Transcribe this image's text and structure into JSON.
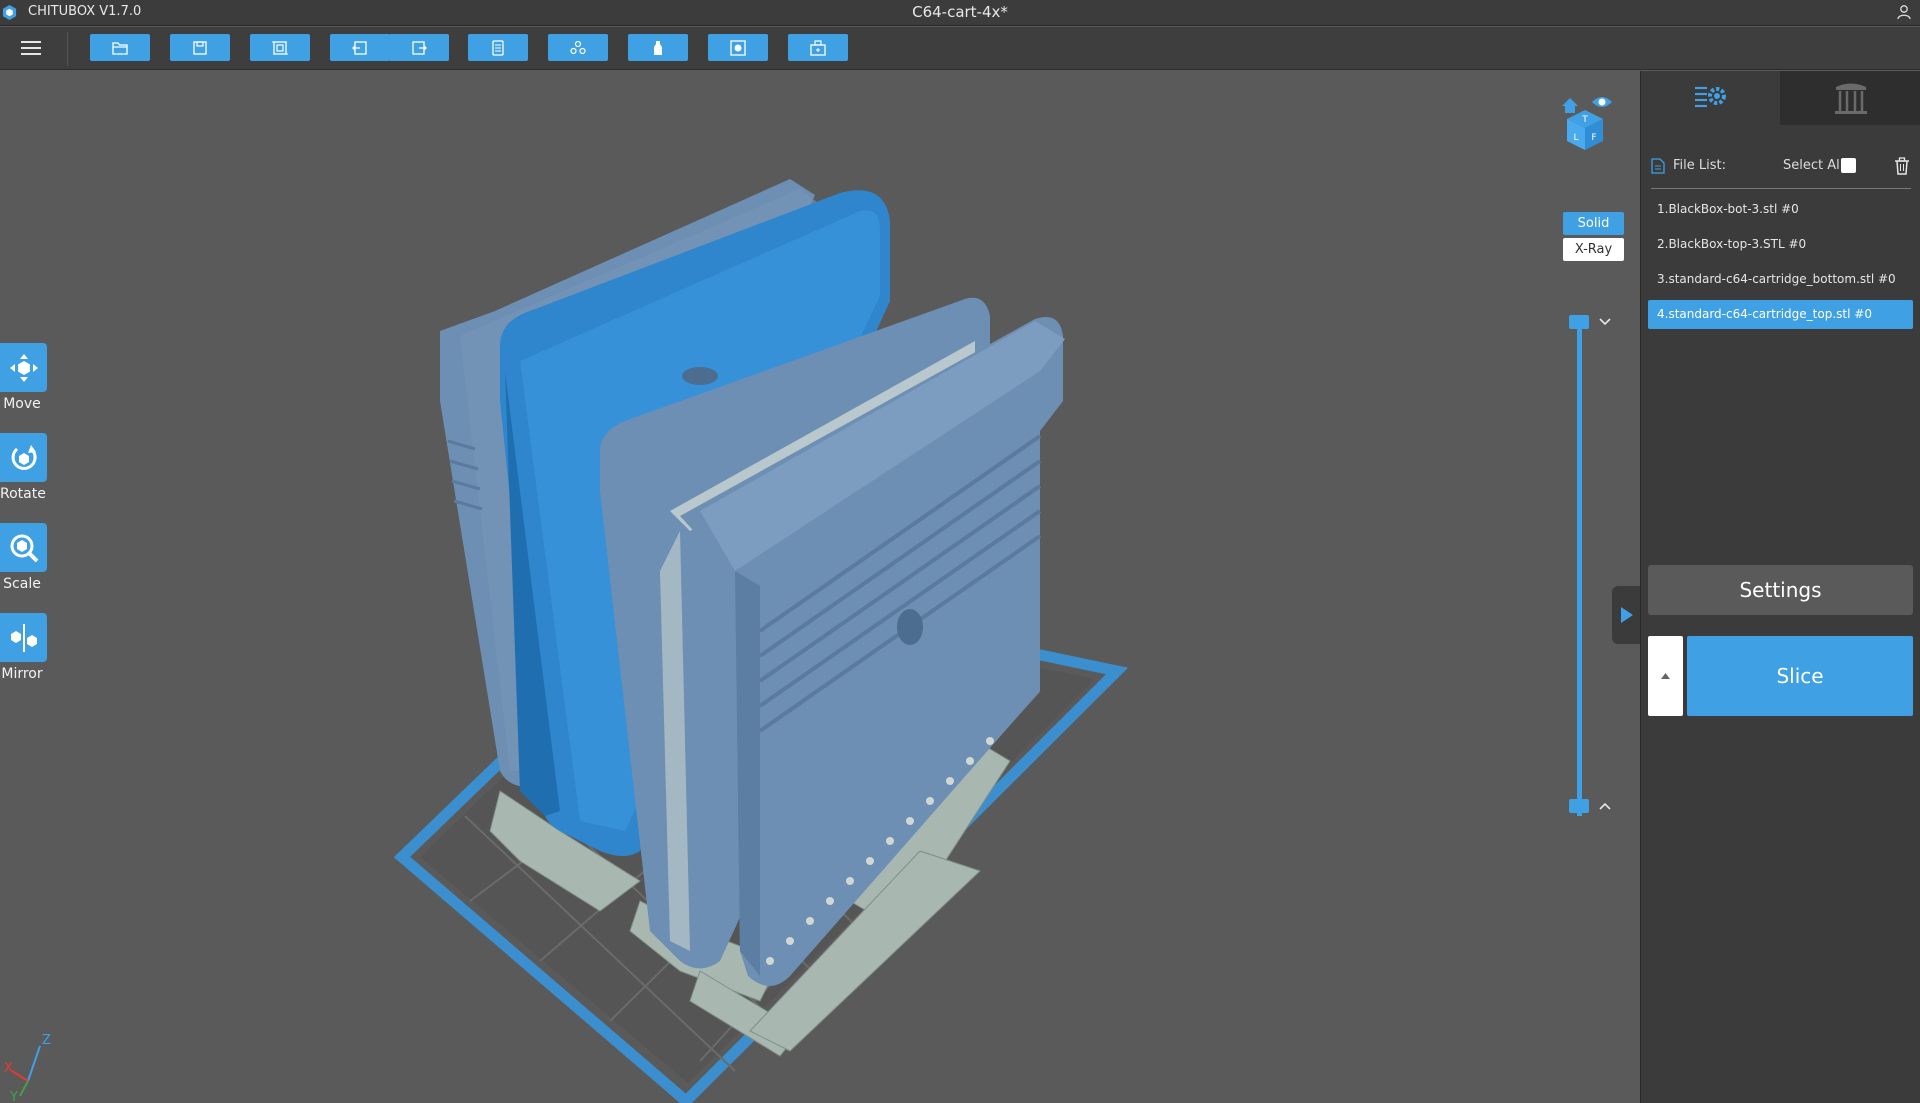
{
  "window": {
    "app_name": "CHITUBOX V1.7.0",
    "doc_title": "C64-cart-4x*"
  },
  "toolbar": {
    "buttons": [
      {
        "name": "open-file-button",
        "icon": "folder-icon"
      },
      {
        "name": "save-button",
        "icon": "save-icon"
      },
      {
        "name": "auto-layout-button",
        "icon": "frame-icon"
      },
      {
        "name": "undo-button",
        "icon": "undo-icon"
      },
      {
        "name": "redo-button",
        "icon": "redo-icon"
      },
      {
        "name": "list-button",
        "icon": "document-icon"
      },
      {
        "name": "hollow-button",
        "icon": "group-icon"
      },
      {
        "name": "support-button",
        "icon": "support-icon"
      },
      {
        "name": "dig-hole-button",
        "icon": "cube-icon"
      },
      {
        "name": "printer-button",
        "icon": "printer-icon"
      }
    ]
  },
  "tools": [
    {
      "label": "Move",
      "icon": "move-icon"
    },
    {
      "label": "Rotate",
      "icon": "rotate-icon"
    },
    {
      "label": "Scale",
      "icon": "scale-icon"
    },
    {
      "label": "Mirror",
      "icon": "mirror-icon"
    }
  ],
  "view": {
    "solid_label": "Solid",
    "xray_label": "X-Ray",
    "mode": "Solid"
  },
  "view_cube": {
    "faces": [
      "T",
      "L",
      "F"
    ]
  },
  "axes": {
    "x_label": "X",
    "y_label": "Y",
    "z_label": "Z"
  },
  "panel": {
    "file_list_label": "File List:",
    "select_all_label": "Select All",
    "select_all_checked": false,
    "files": [
      {
        "label": "1.BlackBox-bot-3.stl #0",
        "selected": false
      },
      {
        "label": "2.BlackBox-top-3.STL #0",
        "selected": false
      },
      {
        "label": "3.standard-c64-cartridge_bottom.stl #0",
        "selected": false
      },
      {
        "label": "4.standard-c64-cartridge_top.stl #0",
        "selected": true
      }
    ],
    "settings_label": "Settings",
    "slice_label": "Slice"
  },
  "colors": {
    "accent": "#3fa0e4",
    "model_selected": "#2f86cc",
    "model": "#6d8fb3",
    "support": "#a8b8b0",
    "background": "#5a5a5a"
  }
}
